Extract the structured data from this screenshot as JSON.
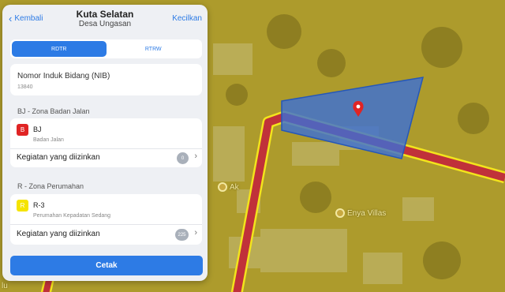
{
  "header": {
    "back_label": "Kembali",
    "title": "Kuta Selatan",
    "subtitle": "Desa Ungasan",
    "shrink_label": "Kecilkan"
  },
  "tabs": [
    {
      "label": "RDTR",
      "active": true
    },
    {
      "label": "RTRW",
      "active": false
    }
  ],
  "nib": {
    "label": "Nomor Induk Bidang (NIB)",
    "value": "13840"
  },
  "zones": [
    {
      "section_title": "BJ - Zona Badan Jalan",
      "badge": "B",
      "badge_color": "#e02424",
      "badge_text_color": "#ffffff",
      "code": "BJ",
      "name": "Badan Jalan",
      "activities_label": "Kegiatan yang diizinkan",
      "count": "0"
    },
    {
      "section_title": "R - Zona Perumahan",
      "badge": "R",
      "badge_color": "#f5e400",
      "badge_text_color": "#ffffff",
      "code": "R-3",
      "name": "Perumahan Kepadatan Sedang",
      "activities_label": "Kegiatan yang diizinkan",
      "count": "225"
    }
  ],
  "print_label": "Cetak",
  "map": {
    "poi_1": "Ak",
    "poi_2": "Enya Villas",
    "bottom_left_label": "lu"
  },
  "colors": {
    "accent": "#2d7be5",
    "map_overlay": "#b3a02b",
    "road": "#c0313a",
    "parcel": "#3a6fd8",
    "pin": "#e02424"
  }
}
